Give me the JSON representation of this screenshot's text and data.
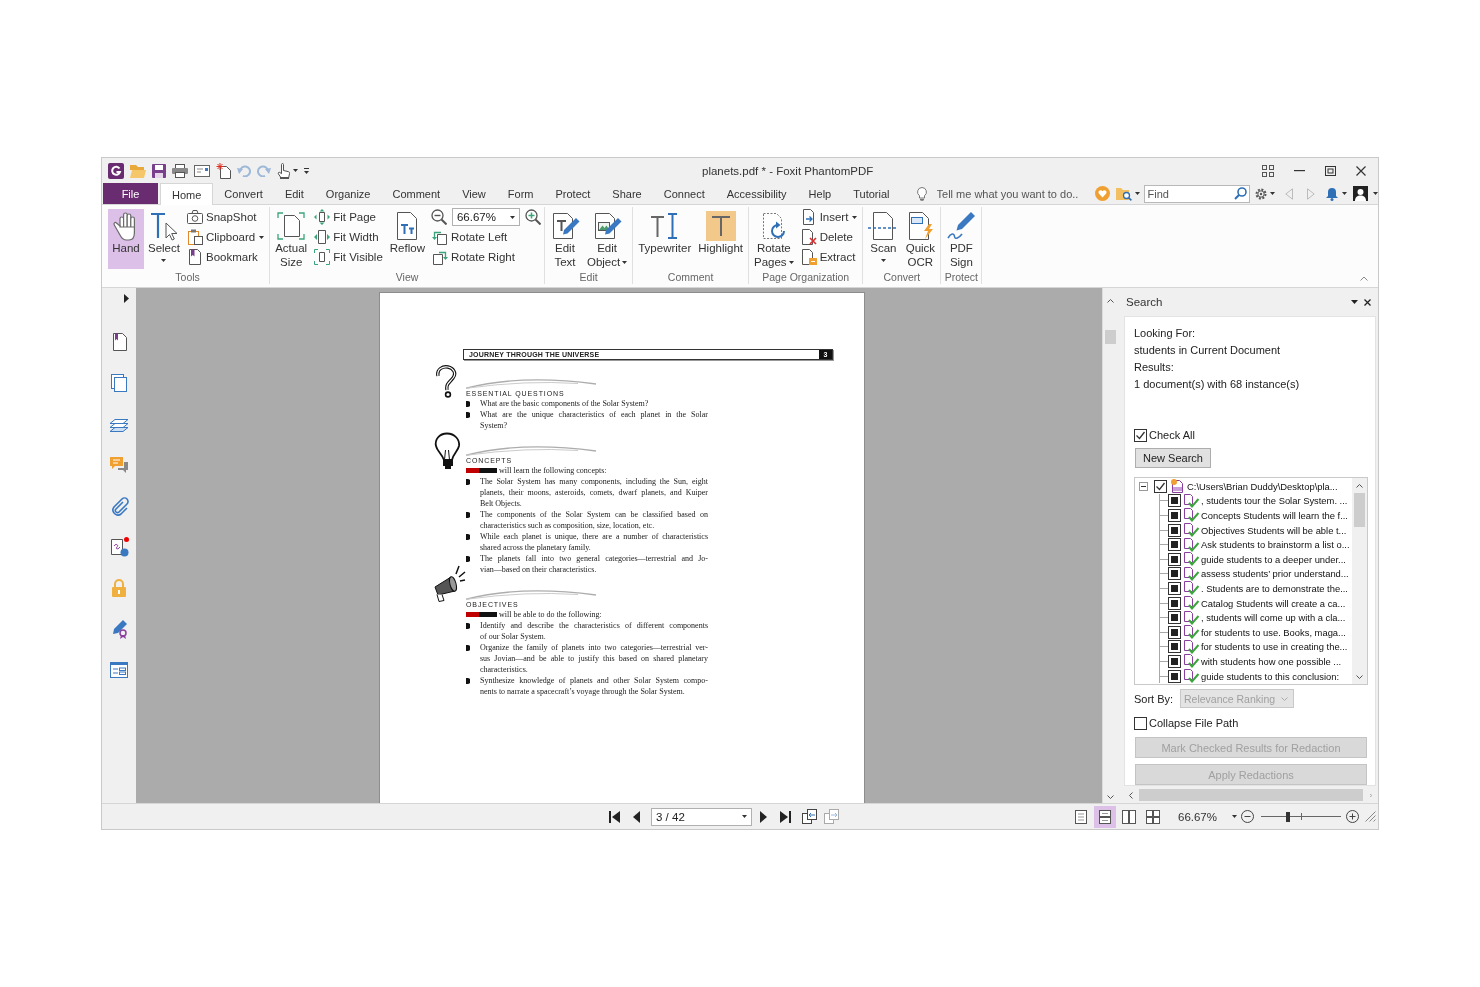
{
  "window": {
    "title": "planets.pdf * - Foxit PhantomPDF"
  },
  "menu_tabs": [
    {
      "label": "File",
      "kind": "file",
      "selected": false
    },
    {
      "label": "Home",
      "kind": "tab",
      "selected": true
    },
    {
      "label": "Convert",
      "kind": "tab",
      "selected": false
    },
    {
      "label": "Edit",
      "kind": "tab",
      "selected": false
    },
    {
      "label": "Organize",
      "kind": "tab",
      "selected": false
    },
    {
      "label": "Comment",
      "kind": "tab",
      "selected": false
    },
    {
      "label": "View",
      "kind": "tab",
      "selected": false
    },
    {
      "label": "Form",
      "kind": "tab",
      "selected": false
    },
    {
      "label": "Protect",
      "kind": "tab",
      "selected": false
    },
    {
      "label": "Share",
      "kind": "tab",
      "selected": false
    },
    {
      "label": "Connect",
      "kind": "tab",
      "selected": false
    },
    {
      "label": "Accessibility",
      "kind": "tab",
      "selected": false
    },
    {
      "label": "Help",
      "kind": "tab",
      "selected": false
    },
    {
      "label": "Tutorial",
      "kind": "tab",
      "selected": false
    }
  ],
  "tell_me": {
    "placeholder": "Tell me what you want to do.."
  },
  "find": {
    "placeholder": "Find"
  },
  "ribbon": {
    "groups": [
      {
        "label": "Tools",
        "items": [
          {
            "kind": "large",
            "label": "Hand",
            "selected": true
          },
          {
            "kind": "large",
            "label": "Select",
            "dropdown": true,
            "selected": false
          },
          {
            "kind": "small",
            "label": "SnapShot",
            "selected": false
          },
          {
            "kind": "small",
            "label": "Clipboard",
            "dropdown": true,
            "selected": false
          },
          {
            "kind": "small",
            "label": "Bookmark",
            "selected": false
          }
        ]
      },
      {
        "label": "View",
        "items": [
          {
            "kind": "large",
            "label": "Actual\nSize"
          },
          {
            "kind": "small",
            "label": "Fit Page"
          },
          {
            "kind": "small",
            "label": "Fit Width"
          },
          {
            "kind": "small",
            "label": "Fit Visible"
          },
          {
            "kind": "large",
            "label": "Reflow"
          },
          {
            "kind": "zoom",
            "value": "66.67%"
          },
          {
            "kind": "small",
            "label": "Rotate Left"
          },
          {
            "kind": "small",
            "label": "Rotate Right"
          }
        ]
      },
      {
        "label": "Edit",
        "items": [
          {
            "kind": "large",
            "label": "Edit\nText"
          },
          {
            "kind": "large",
            "label": "Edit\nObject",
            "dropdown": true
          }
        ]
      },
      {
        "label": "Comment",
        "items": [
          {
            "kind": "large",
            "label": "Typewriter"
          },
          {
            "kind": "large",
            "label": "Highlight"
          }
        ]
      },
      {
        "label": "Page Organization",
        "items": [
          {
            "kind": "large",
            "label": "Rotate\nPages",
            "dropdown": true
          },
          {
            "kind": "small",
            "label": "Insert",
            "dropdown": true
          },
          {
            "kind": "small",
            "label": "Delete"
          },
          {
            "kind": "small",
            "label": "Extract"
          }
        ]
      },
      {
        "label": "Convert",
        "items": [
          {
            "kind": "large",
            "label": "Scan",
            "dropdown": true
          },
          {
            "kind": "large",
            "label": "Quick\nOCR"
          }
        ]
      },
      {
        "label": "Protect",
        "items": [
          {
            "kind": "large",
            "label": "PDF\nSign"
          }
        ]
      }
    ]
  },
  "document": {
    "page": {
      "header": "JOURNEY THROUGH THE UNIVERSE",
      "page_number": "3",
      "sections": [
        {
          "heading": "ESSENTIAL QUESTIONS",
          "bullets": [
            {
              "lines": [
                "What are the basic components of the Solar System?"
              ]
            },
            {
              "lines": [
                "What are the unique characteristics of each planet in the Solar",
                "System?"
              ]
            }
          ]
        },
        {
          "heading": "CONCEPTS",
          "intro": {
            "redacted": true,
            "text": "will learn the following concepts:"
          },
          "bullets": [
            {
              "lines": [
                "The Solar System has many components, including the Sun, eight",
                "planets, their moons, asteroids, comets, dwarf planets, and Kuiper",
                "Belt Objects."
              ]
            },
            {
              "lines": [
                "The components of the Solar System can be classified based on",
                "characteristics such as composition, size, location, etc."
              ]
            },
            {
              "lines": [
                "While each planet is unique, there are a number of characteristics",
                "shared across the planetary family."
              ]
            },
            {
              "lines": [
                "The planets fall into two general categories—terrestrial and Jo-",
                "vian—based on their characteristics."
              ]
            }
          ]
        },
        {
          "heading": "OBJECTIVES",
          "intro": {
            "redacted": true,
            "text": "will be able to do the following:"
          },
          "bullets": [
            {
              "lines": [
                "Identify and describe the characteristics of different components",
                "of our Solar System."
              ]
            },
            {
              "lines": [
                "Organize the family of planets into two categories—terrestrial ver-",
                "sus Jovian—and be able to justify this based on shared planetary",
                "characteristics."
              ]
            },
            {
              "lines": [
                "Synthesize knowledge of planets and other Solar System compo-",
                "nents to narrate a spacecraft’s voyage through the Solar System."
              ]
            }
          ]
        }
      ]
    }
  },
  "search_panel": {
    "title": "Search",
    "looking_for_label": "Looking For:",
    "query": "students in Current Document",
    "results_label": "Results:",
    "summary": "1 document(s) with 68 instance(s)",
    "check_all": {
      "label": "Check All",
      "checked": true
    },
    "new_search": "New Search",
    "results": {
      "label": "C:\\Users\\Brian Duddy\\Desktop\\pla...",
      "checked": true,
      "expanded": true,
      "children": [
        {
          "label": ", students tour the Solar System. ...",
          "checked": true
        },
        {
          "label": "Concepts Students will learn the f...",
          "checked": true
        },
        {
          "label": "Objectives Students will be able t...",
          "checked": true
        },
        {
          "label": "Ask students to brainstorm a list o...",
          "checked": true
        },
        {
          "label": "guide students to a deeper under...",
          "checked": true
        },
        {
          "label": "assess students’ prior understand...",
          "checked": true
        },
        {
          "label": ". Students are to demonstrate the...",
          "checked": true
        },
        {
          "label": "Catalog Students will create a ca...",
          "checked": true
        },
        {
          "label": ", students will come up with a cla...",
          "checked": true
        },
        {
          "label": "for students to use. Books, maga...",
          "checked": true
        },
        {
          "label": "for students to use in creating the...",
          "checked": true
        },
        {
          "label": "with students how one possible ...",
          "checked": true
        },
        {
          "label": "guide students to this conclusion:",
          "checked": true
        }
      ]
    },
    "sort_by": {
      "label": "Sort By:",
      "value": "Relevance Ranking",
      "disabled": true
    },
    "collapse_file_path": {
      "label": "Collapse File Path",
      "checked": false
    },
    "buttons": [
      {
        "label": "Mark Checked Results for Redaction",
        "disabled": true
      },
      {
        "label": "Apply Redactions",
        "disabled": true
      }
    ]
  },
  "page_nav": {
    "value": "3 / 42"
  },
  "view_modes": [
    {
      "selected": false
    },
    {
      "selected": true
    },
    {
      "selected": false
    },
    {
      "selected": false
    }
  ],
  "zoom": {
    "value": "66.67%",
    "level": 0.34
  }
}
